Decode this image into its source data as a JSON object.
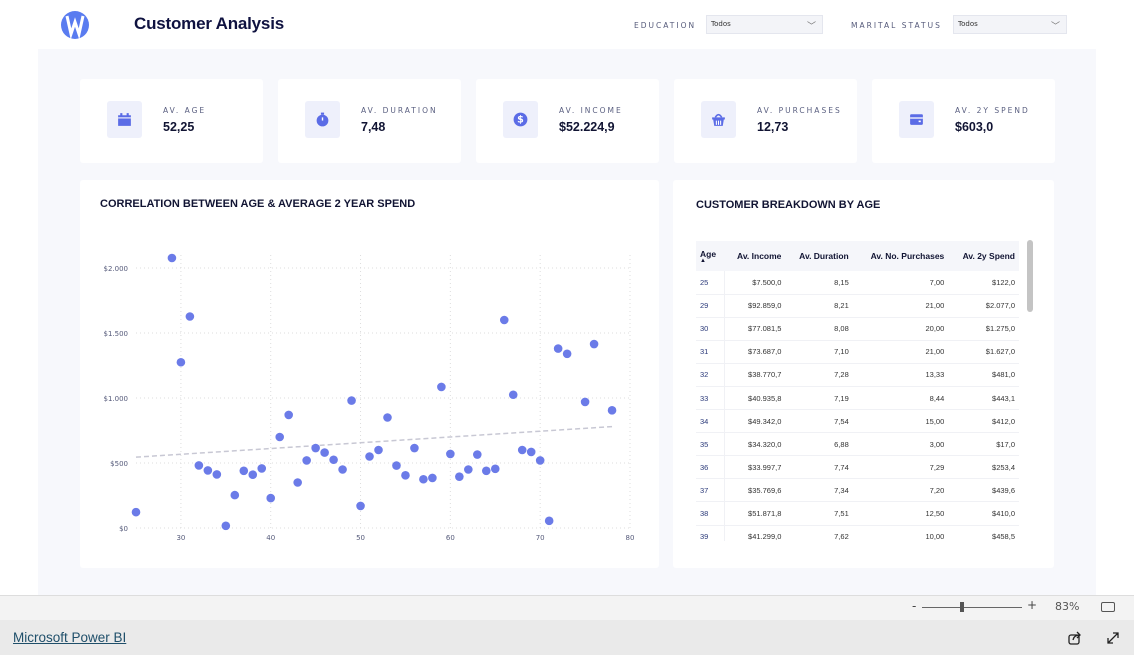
{
  "header": {
    "title": "Customer Analysis",
    "filters": [
      {
        "label": "EDUCATION",
        "value": "Todos"
      },
      {
        "label": "MARITAL STATUS",
        "value": "Todos"
      }
    ]
  },
  "kpis": [
    {
      "label": "AV. AGE",
      "value": "52,25",
      "icon": "calendar-icon"
    },
    {
      "label": "AV. DURATION",
      "value": "7,48",
      "icon": "stopwatch-icon"
    },
    {
      "label": "AV. INCOME",
      "value": "$52.224,9",
      "icon": "dollar-coin-icon"
    },
    {
      "label": "AV. PURCHASES",
      "value": "12,73",
      "icon": "basket-icon"
    },
    {
      "label": "AV. 2Y SPEND",
      "value": "$603,0",
      "icon": "wallet-icon"
    }
  ],
  "accent": "#6b7be8",
  "chart_data": {
    "type": "scatter",
    "title": "CORRELATION BETWEEN AGE & AVERAGE 2 YEAR SPEND",
    "xlim": [
      25,
      80
    ],
    "ylim": [
      0,
      2100
    ],
    "xticks": [
      "30",
      "40",
      "50",
      "60",
      "70",
      "80"
    ],
    "yticks": [
      "$0",
      "$500",
      "$1.000",
      "$1.500",
      "$2.000"
    ],
    "grid": true,
    "trendline": {
      "from": [
        25,
        545
      ],
      "to": [
        78,
        780
      ]
    },
    "points": [
      [
        25,
        122
      ],
      [
        29,
        2077
      ],
      [
        30,
        1275
      ],
      [
        31,
        1627
      ],
      [
        32,
        481
      ],
      [
        33,
        443
      ],
      [
        34,
        412
      ],
      [
        35,
        17
      ],
      [
        36,
        253
      ],
      [
        37,
        440
      ],
      [
        38,
        410
      ],
      [
        39,
        458
      ],
      [
        40,
        230
      ],
      [
        41,
        700
      ],
      [
        42,
        870
      ],
      [
        43,
        350
      ],
      [
        44,
        520
      ],
      [
        45,
        615
      ],
      [
        46,
        580
      ],
      [
        47,
        525
      ],
      [
        48,
        450
      ],
      [
        49,
        980
      ],
      [
        50,
        170
      ],
      [
        51,
        550
      ],
      [
        52,
        600
      ],
      [
        53,
        850
      ],
      [
        54,
        480
      ],
      [
        55,
        405
      ],
      [
        56,
        615
      ],
      [
        57,
        375
      ],
      [
        58,
        385
      ],
      [
        59,
        1085
      ],
      [
        60,
        570
      ],
      [
        61,
        395
      ],
      [
        62,
        450
      ],
      [
        63,
        565
      ],
      [
        64,
        440
      ],
      [
        65,
        455
      ],
      [
        66,
        1600
      ],
      [
        67,
        1025
      ],
      [
        68,
        600
      ],
      [
        69,
        585
      ],
      [
        70,
        520
      ],
      [
        71,
        55
      ],
      [
        72,
        1380
      ],
      [
        73,
        1340
      ],
      [
        75,
        970
      ],
      [
        76,
        1415
      ],
      [
        78,
        905
      ]
    ]
  },
  "table": {
    "title": "CUSTOMER BREAKDOWN BY AGE",
    "columns": [
      "Age",
      "Av. Income",
      "Av. Duration",
      "Av. No. Purchases",
      "Av. 2y Spend"
    ],
    "rows": [
      [
        "25",
        "$7.500,0",
        "8,15",
        "7,00",
        "$122,0"
      ],
      [
        "29",
        "$92.859,0",
        "8,21",
        "21,00",
        "$2.077,0"
      ],
      [
        "30",
        "$77.081,5",
        "8,08",
        "20,00",
        "$1.275,0"
      ],
      [
        "31",
        "$73.687,0",
        "7,10",
        "21,00",
        "$1.627,0"
      ],
      [
        "32",
        "$38.770,7",
        "7,28",
        "13,33",
        "$481,0"
      ],
      [
        "33",
        "$40.935,8",
        "7,19",
        "8,44",
        "$443,1"
      ],
      [
        "34",
        "$49.342,0",
        "7,54",
        "15,00",
        "$412,0"
      ],
      [
        "35",
        "$34.320,0",
        "6,88",
        "3,00",
        "$17,0"
      ],
      [
        "36",
        "$33.997,7",
        "7,74",
        "7,29",
        "$253,4"
      ],
      [
        "37",
        "$35.769,6",
        "7,34",
        "7,20",
        "$439,6"
      ],
      [
        "38",
        "$51.871,8",
        "7,51",
        "12,50",
        "$410,0"
      ],
      [
        "39",
        "$41.299,0",
        "7,62",
        "10,00",
        "$458,5"
      ]
    ]
  },
  "footer": {
    "zoom": "83%",
    "minus": "-",
    "plus": "+",
    "brand": "Microsoft Power BI"
  }
}
